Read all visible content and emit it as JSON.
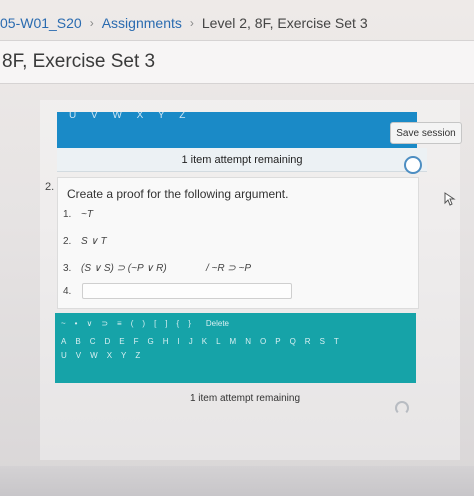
{
  "breadcrumb": {
    "course": "05-W01_S20",
    "assignments": "Assignments",
    "current": "Level 2, 8F, Exercise Set 3"
  },
  "page": {
    "title": "8F, Exercise Set 3"
  },
  "palette_top": {
    "letters": "U V W X Y Z"
  },
  "toolbar": {
    "save_label": "Save session"
  },
  "attempts": {
    "top_text": "1 item attempt remaining",
    "bottom_text": "1 item attempt remaining"
  },
  "question": {
    "number": "2.",
    "prompt": "Create a proof for the following argument.",
    "lines": [
      {
        "num": "1.",
        "formula": "~T"
      },
      {
        "num": "2.",
        "formula": "S ∨ T"
      },
      {
        "num": "3.",
        "formula": "(S ∨ S) ⊃ (~P ∨ R)"
      }
    ],
    "conclusion": "/ ~R ⊃ ~P",
    "input_line_num": "4."
  },
  "keyboard": {
    "symbols": [
      "~",
      "•",
      "∨",
      "⊃",
      "≡",
      "(",
      ")",
      "[",
      "]",
      "{",
      "}"
    ],
    "delete_label": "Delete",
    "row_letters_1": [
      "A",
      "B",
      "C",
      "D",
      "E",
      "F",
      "G",
      "H",
      "I",
      "J",
      "K",
      "L",
      "M",
      "N",
      "O",
      "P",
      "Q",
      "R",
      "S",
      "T"
    ],
    "row_letters_2": [
      "U",
      "V",
      "W",
      "X",
      "Y",
      "Z"
    ]
  },
  "colors": {
    "accent": "#1a8ac7",
    "keyboard": "#16a3a8",
    "link": "#2a6bb0"
  }
}
